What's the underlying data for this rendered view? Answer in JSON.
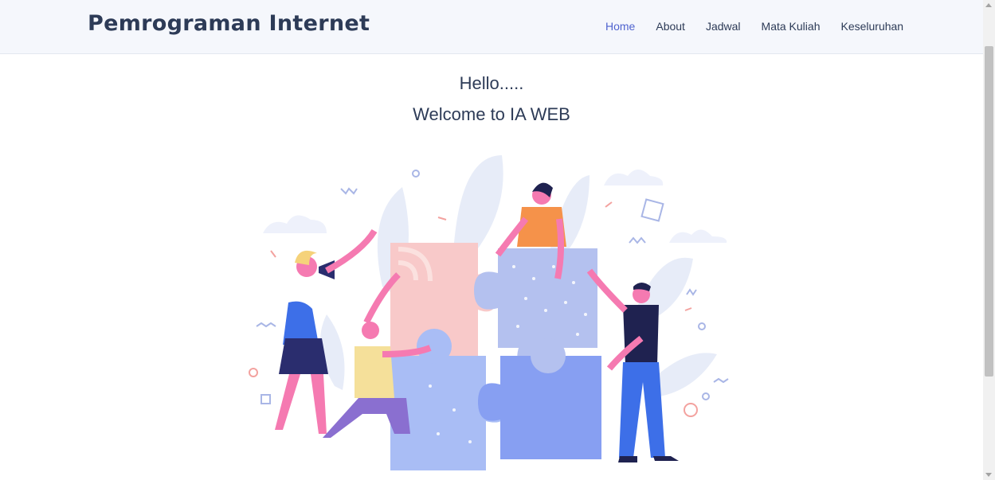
{
  "header": {
    "brand": "Pemrograman Internet",
    "nav": [
      {
        "label": "Home",
        "active": true
      },
      {
        "label": "About",
        "active": false
      },
      {
        "label": "Jadwal",
        "active": false
      },
      {
        "label": "Mata Kuliah",
        "active": false
      },
      {
        "label": "Keseluruhan",
        "active": false
      }
    ]
  },
  "hero": {
    "line1": "Hello.....",
    "line2": "Welcome to IA WEB"
  },
  "colors": {
    "nav_active": "#4f63cf",
    "text": "#2d3b57",
    "navbar_bg": "#f5f7fc"
  }
}
